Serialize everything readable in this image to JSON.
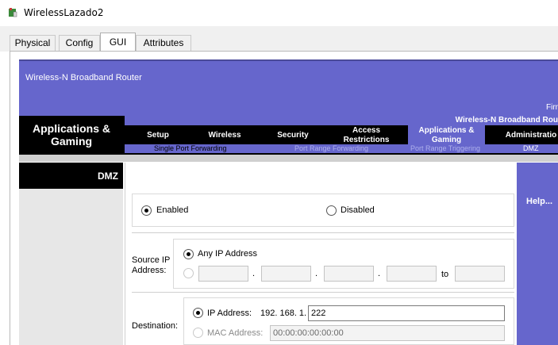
{
  "window": {
    "title": "WirelessLazado2"
  },
  "tabs": [
    {
      "label": "Physical"
    },
    {
      "label": "Config"
    },
    {
      "label": "GUI",
      "active": true
    },
    {
      "label": "Attributes"
    }
  ],
  "router": {
    "brand": "Wireless-N Broadband Router",
    "firmware_label": "Firm",
    "model": "Wireless-N Broadband Rou",
    "section_title": "Applications & Gaming",
    "menu": [
      {
        "label": "Setup"
      },
      {
        "label": "Wireless"
      },
      {
        "label": "Security"
      },
      {
        "label": "Access Restrictions"
      },
      {
        "label": "Applications & Gaming",
        "active": true
      },
      {
        "label": "Administratio"
      }
    ],
    "submenu": [
      {
        "label": "Single Port Forwarding"
      },
      {
        "label": "Port Range Forwarding"
      },
      {
        "label": "Port Range Triggering"
      },
      {
        "label": "DMZ",
        "active": true
      }
    ],
    "page_label": "DMZ",
    "help": "Help...",
    "dmz": {
      "enabled_label": "Enabled",
      "disabled_label": "Disabled",
      "state": "enabled",
      "source_label": "Source IP Address:",
      "any_ip_label": "Any IP Address",
      "range_to_label": "to",
      "range_dot": ".",
      "destination_label": "Destination:",
      "ip_address_label": "IP Address:",
      "ip_prefix": "192. 168. 1.",
      "ip_last_octet": "222",
      "mac_address_label": "MAC Address:",
      "mac_address_value": "00:00:00:00:00:00"
    }
  },
  "colors": {
    "router_purple": "#6666cc",
    "nav_black": "#000000"
  }
}
